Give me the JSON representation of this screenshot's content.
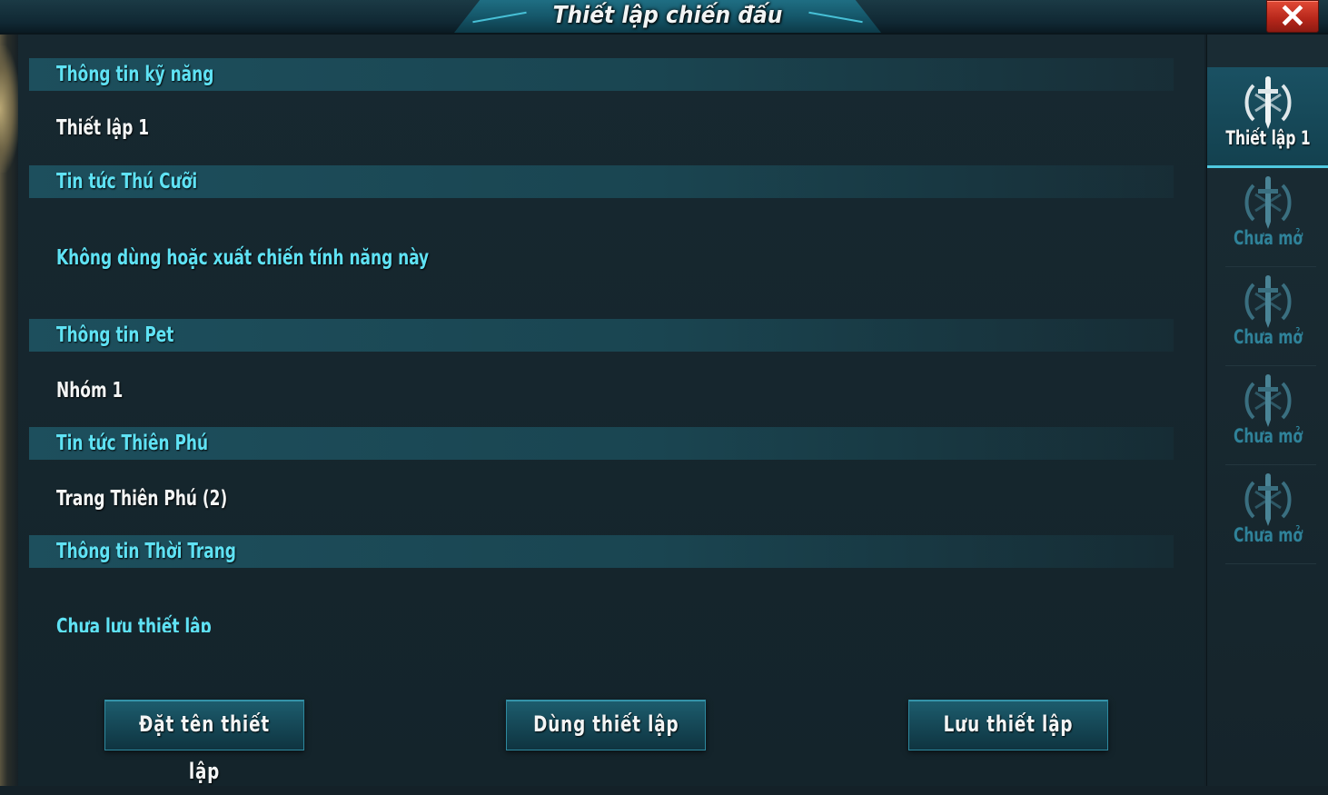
{
  "title": "Thiết lập chiến đấu",
  "close_icon": "✕",
  "sections": [
    {
      "header": "Thông tin kỹ năng",
      "value": "Thiết lập 1"
    },
    {
      "header": "Tin tức Thú Cưỡi",
      "value": "Không dùng hoặc xuất chiến tính năng này"
    },
    {
      "header": "Thông tin Pet",
      "value": "Nhóm 1"
    },
    {
      "header": "Tin tức Thiên Phú",
      "value": "Trang Thiên Phú (2)"
    },
    {
      "header": "Thông tin Thời Trang",
      "value": "Chưa lưu thiết lập"
    }
  ],
  "buttons": {
    "rename": "Đặt tên thiết lập",
    "use": "Dùng thiết lập",
    "save": "Lưu thiết lập"
  },
  "sidebar": {
    "items": [
      {
        "label": "Thiết lập 1",
        "icon": "sword-emblem-icon",
        "active": true
      },
      {
        "label": "Chưa mở",
        "icon": "sword-emblem-icon",
        "active": false
      },
      {
        "label": "Chưa mở",
        "icon": "sword-emblem-icon",
        "active": false
      },
      {
        "label": "Chưa mở",
        "icon": "sword-emblem-icon",
        "active": false
      },
      {
        "label": "Chưa mở",
        "icon": "sword-emblem-icon",
        "active": false
      }
    ]
  },
  "colors": {
    "header_text": "#5fe2f4",
    "value_text": "#f3f5f5",
    "close_button": "#c8301f",
    "panel_bg": "#142128"
  }
}
